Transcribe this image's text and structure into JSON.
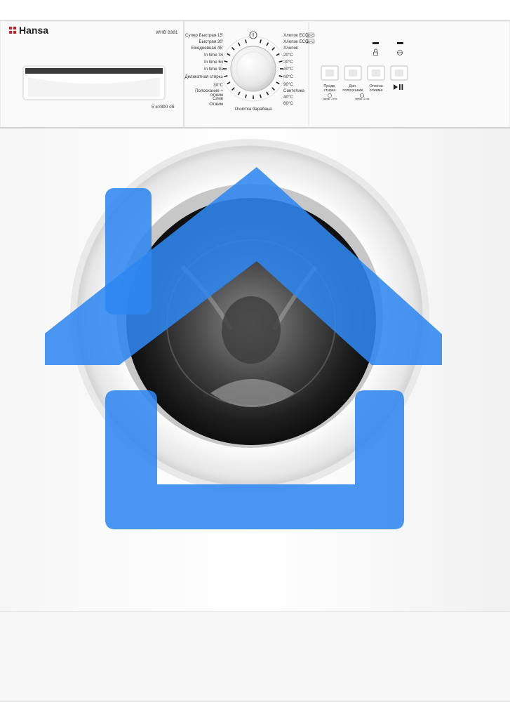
{
  "brand": {
    "name": "Hansa"
  },
  "model": {
    "name": "WHB 8381",
    "capacity": "5 кг/800 об"
  },
  "programs_left": [
    "Супер Быстрая 15'",
    "Быстрая 30'",
    "Ежедневная 45'",
    "In time 3ч",
    "In time 6ч",
    "In time 9ч",
    "Деликатная стирка",
    "30°C",
    "Полоскание +",
    "отжим",
    "Слив",
    "Отжим"
  ],
  "programs_right": [
    "Хлопок ECO",
    "Хлопок ECO",
    "Хлопок",
    "20°C",
    "30°C",
    "40°C",
    "60°C",
    "90°C",
    "Синтетика",
    "40°C",
    "60°C"
  ],
  "program_bottom": "Очистка барабана",
  "eco_badges": [
    "40°C",
    "60°C"
  ],
  "buttons": [
    {
      "label_1": "Предв.",
      "label_2": "стирка",
      "sub": "Удерж. 3 сек"
    },
    {
      "label_1": "Доп.",
      "label_2": "полоскание",
      "sub": ""
    },
    {
      "label_1": "Отмена",
      "label_2": "отжима",
      "sub": "Удерж. 3 сек"
    },
    {
      "label_1": "",
      "label_2": "",
      "sub": ""
    }
  ],
  "colors": {
    "body": "#f4f4f4",
    "overlay_blue": "#2f86f0",
    "brand_red": "#d21f26",
    "drum_dark": "#2a2a2a"
  }
}
